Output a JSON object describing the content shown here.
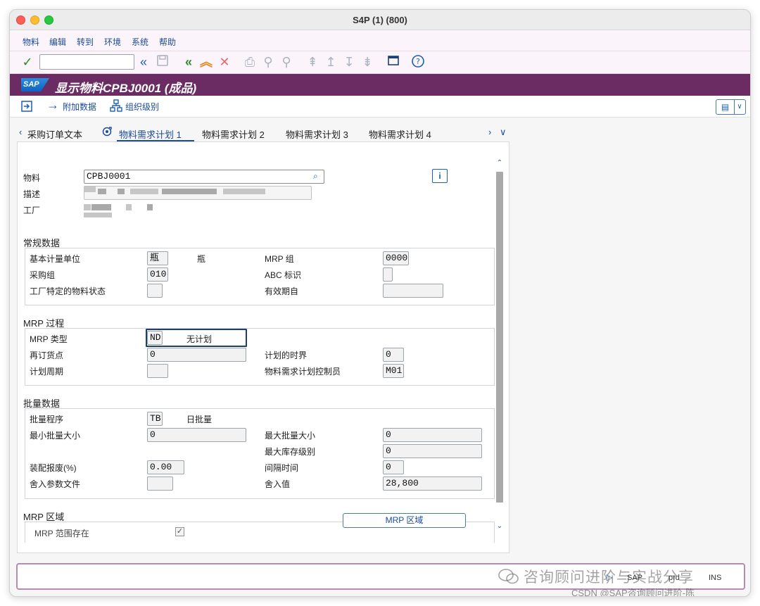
{
  "window": {
    "title": "S4P (1) (800)"
  },
  "menu": [
    "物料",
    "编辑",
    "转到",
    "环境",
    "系统",
    "帮助"
  ],
  "header": {
    "title": "显示物料CPBJ0001 (成品)",
    "logo": "SAP"
  },
  "app_toolbar": {
    "additional_data": "附加数据",
    "org_levels": "组织级别"
  },
  "tabs": [
    {
      "label": "采购订单文本",
      "active": false
    },
    {
      "label": "物料需求计划 1",
      "active": true
    },
    {
      "label": "物料需求计划 2",
      "active": false
    },
    {
      "label": "物料需求计划 3",
      "active": false
    },
    {
      "label": "物料需求计划 4",
      "active": false
    }
  ],
  "material": {
    "material_label": "物料",
    "material_value": "CPBJ0001",
    "desc_label": "描述",
    "plant_label": "工厂"
  },
  "general": {
    "title": "常规数据",
    "base_uom_label": "基本计量单位",
    "base_uom_value": "瓶",
    "base_uom_text": "瓶",
    "mrp_group_label": "MRP 组",
    "mrp_group_value": "0000",
    "purch_group_label": "采购组",
    "purch_group_value": "010",
    "abc_label": "ABC 标识",
    "abc_value": "",
    "plant_status_label": "工厂特定的物料状态",
    "plant_status_value": "",
    "valid_from_label": "有效期自",
    "valid_from_value": ""
  },
  "mrp_proc": {
    "title": "MRP 过程",
    "mrp_type_label": "MRP 类型",
    "mrp_type_value": "ND",
    "mrp_type_text": "无计划",
    "reorder_label": "再订货点",
    "reorder_value": "0",
    "time_fence_label": "计划的时界",
    "time_fence_value": "0",
    "cycle_label": "计划周期",
    "cycle_value": "",
    "controller_label": "物料需求计划控制员",
    "controller_value": "M01"
  },
  "lot": {
    "title": "批量数据",
    "lot_proc_label": "批量程序",
    "lot_proc_value": "TB",
    "lot_proc_text": "日批量",
    "min_lot_label": "最小批量大小",
    "min_lot_value": "0",
    "max_lot_label": "最大批量大小",
    "max_lot_value": "0",
    "max_stock_label": "最大库存级别",
    "max_stock_value": "0",
    "scrap_label": "装配报废(%)",
    "scrap_value": "0.00",
    "interval_label": "间隔时间",
    "interval_value": "0",
    "rounding_profile_label": "舍入参数文件",
    "rounding_profile_value": "",
    "rounding_label": "舍入值",
    "rounding_value": "28,800"
  },
  "mrp_area": {
    "title": "MRP 区域",
    "exists_label": "MRP 范围存在",
    "exists_checked": true,
    "button_label": "MRP 区域"
  },
  "status": {
    "system": "SAP",
    "client": "prd",
    "mode": "INS"
  },
  "watermark": {
    "line1": "咨询顾问进阶与实战分享",
    "line2": "CSDN @SAP咨询顾问进阶-陈"
  }
}
